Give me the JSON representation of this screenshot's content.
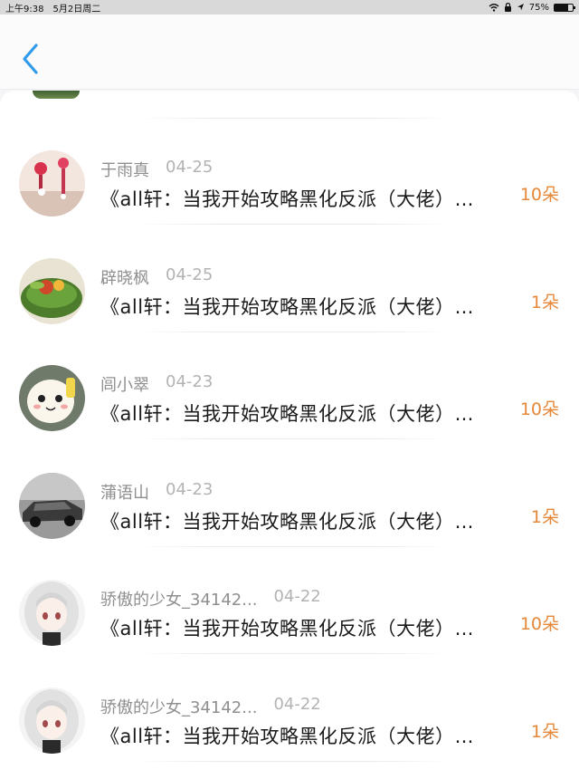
{
  "status_bar": {
    "time": "上午9:38",
    "date": "5月2日周二",
    "battery": "75%",
    "battery_level": 0.75
  },
  "nav": {
    "back_icon": "chevron-left-icon",
    "accent_color": "#2f9bea"
  },
  "gift_color": "#e6883a",
  "comments": [
    {
      "name": "于雨真",
      "date": "04-25",
      "title": "《all轩：当我开始攻略黑化反派（大佬）…",
      "gift": "10朵",
      "avatar": "lantern-avatar"
    },
    {
      "name": "辟晓枫",
      "date": "04-25",
      "title": "《all轩：当我开始攻略黑化反派（大佬）…",
      "gift": "1朵",
      "avatar": "food-avatar"
    },
    {
      "name": "闾小翠",
      "date": "04-23",
      "title": "《all轩：当我开始攻略黑化反派（大佬）…",
      "gift": "10朵",
      "avatar": "cartoon-avatar"
    },
    {
      "name": "蒲语山",
      "date": "04-23",
      "title": "《all轩：当我开始攻略黑化反派（大佬）…",
      "gift": "1朵",
      "avatar": "car-avatar"
    },
    {
      "name": "骄傲的少女_34142...",
      "date": "04-22",
      "title": "《all轩：当我开始攻略黑化反派（大佬）…",
      "gift": "10朵",
      "avatar": "anime-girl-avatar"
    },
    {
      "name": "骄傲的少女_34142...",
      "date": "04-22",
      "title": "《all轩：当我开始攻略黑化反派（大佬）…",
      "gift": "1朵",
      "avatar": "anime-girl-avatar"
    }
  ]
}
